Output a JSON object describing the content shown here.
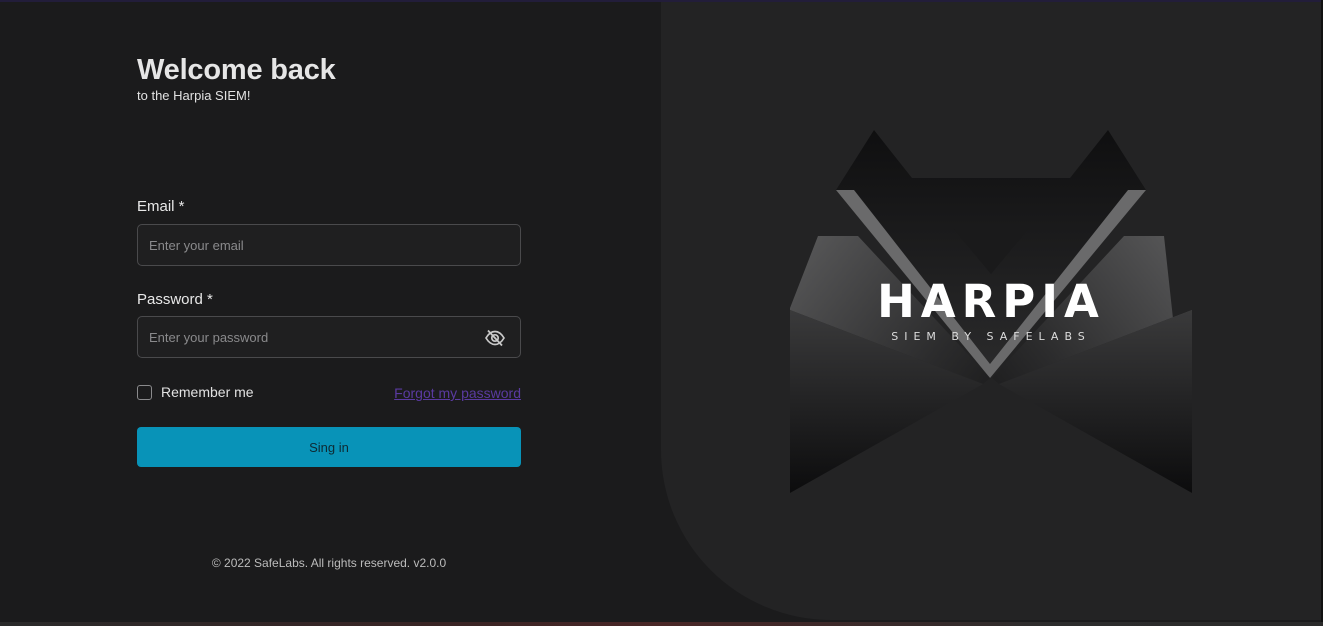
{
  "login": {
    "title": "Welcome back",
    "subtitle": "to the Harpia SIEM!",
    "email_label": "Email *",
    "email_placeholder": "Enter your email",
    "password_label": "Password *",
    "password_placeholder": "Enter your password",
    "remember_label": "Remember me",
    "forgot_label": "Forgot my password",
    "signin_label": "Sing in"
  },
  "footer": {
    "text": "© 2022 SafeLabs. All rights reserved. v2.0.0"
  },
  "brand": {
    "name": "HARPIA",
    "tagline": "SIEM BY SAFELABS"
  },
  "icons": {
    "password_toggle": "eye-off-icon",
    "logo": "harpia-logo"
  },
  "colors": {
    "accent": "#0893b8",
    "link": "#5a3aa0",
    "background": "#1b1b1c",
    "panel": "#232324"
  }
}
